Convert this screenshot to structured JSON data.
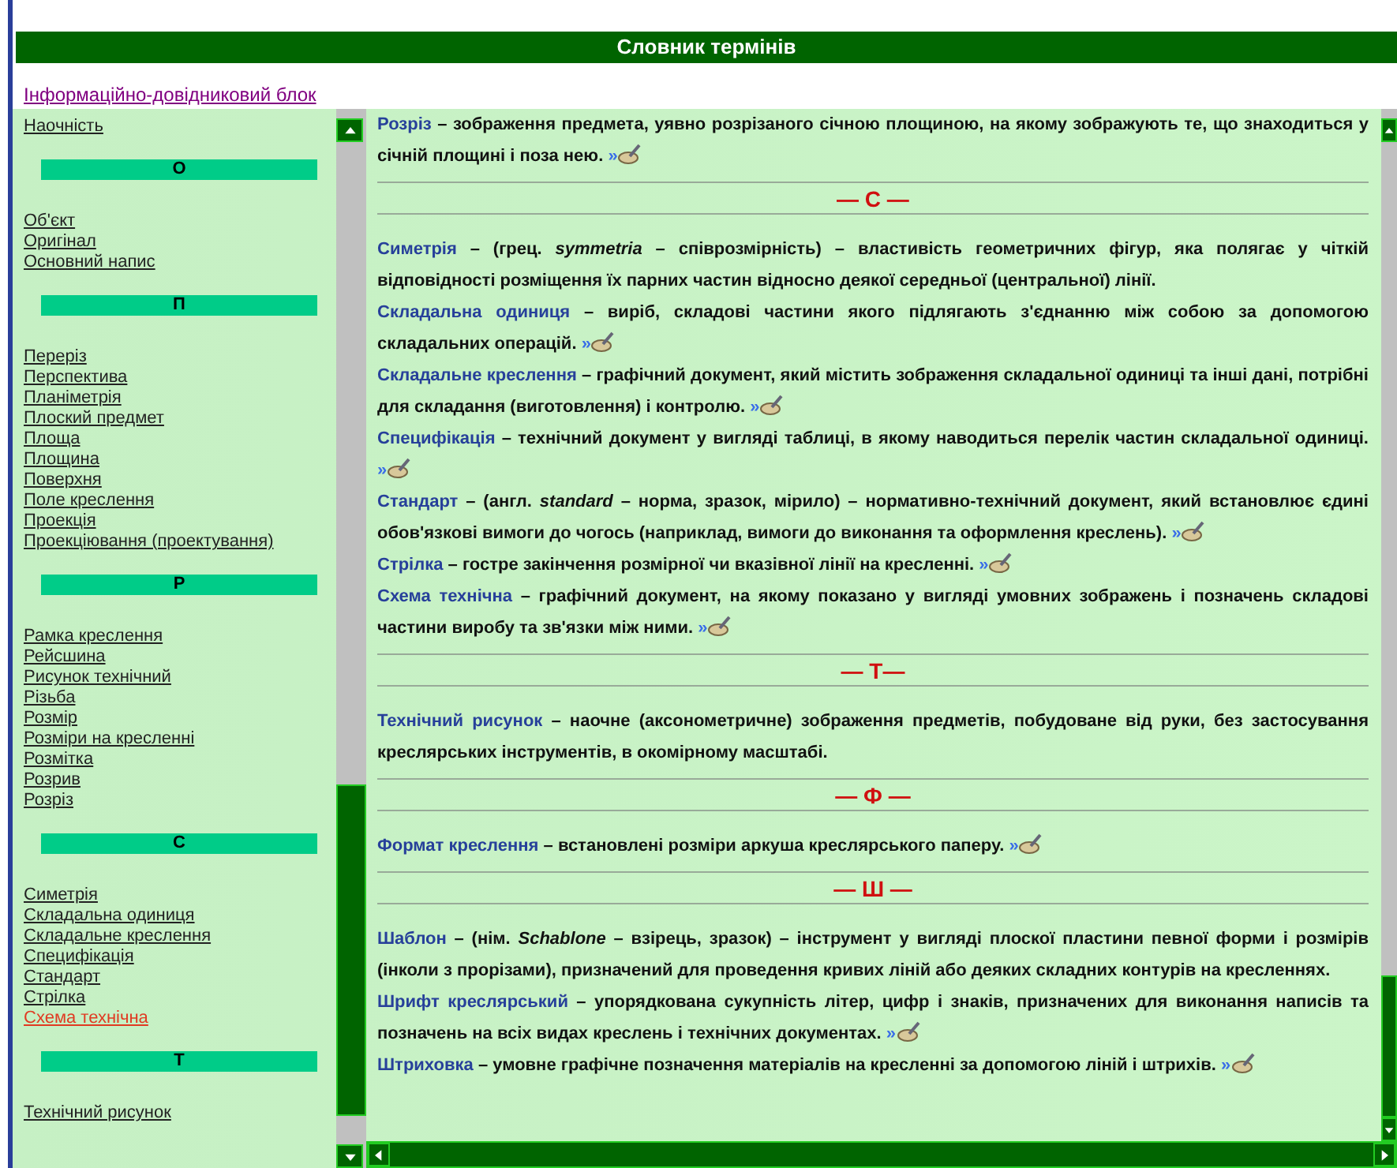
{
  "window": {
    "title": "Словник термінів"
  },
  "breadcrumb": {
    "label": "Інформаційно-довідниковий блок"
  },
  "sidebar": {
    "items": [
      {
        "kind": "link",
        "label": "Наочність",
        "selected": false
      },
      {
        "kind": "header",
        "label": "О"
      },
      {
        "kind": "link",
        "label": "Об'єкт",
        "selected": false
      },
      {
        "kind": "link",
        "label": "Оригінал",
        "selected": false
      },
      {
        "kind": "link",
        "label": "Основний напис",
        "selected": false
      },
      {
        "kind": "header",
        "label": "П"
      },
      {
        "kind": "link",
        "label": "Переріз",
        "selected": false
      },
      {
        "kind": "link",
        "label": "Перспектива",
        "selected": false
      },
      {
        "kind": "link",
        "label": "Планіметрія",
        "selected": false
      },
      {
        "kind": "link",
        "label": "Плоский предмет",
        "selected": false
      },
      {
        "kind": "link",
        "label": "Площа",
        "selected": false
      },
      {
        "kind": "link",
        "label": "Площина",
        "selected": false
      },
      {
        "kind": "link",
        "label": "Поверхня",
        "selected": false
      },
      {
        "kind": "link",
        "label": "Поле креслення",
        "selected": false
      },
      {
        "kind": "link",
        "label": "Проекція",
        "selected": false
      },
      {
        "kind": "link",
        "label": "Проекціювання (проектування)",
        "selected": false
      },
      {
        "kind": "header",
        "label": "Р"
      },
      {
        "kind": "link",
        "label": "Рамка креслення",
        "selected": false
      },
      {
        "kind": "link",
        "label": "Рейсшина",
        "selected": false
      },
      {
        "kind": "link",
        "label": "Рисунок технічний",
        "selected": false
      },
      {
        "kind": "link",
        "label": "Різьба",
        "selected": false
      },
      {
        "kind": "link",
        "label": "Розмір",
        "selected": false
      },
      {
        "kind": "link",
        "label": "Розміри на кресленні",
        "selected": false
      },
      {
        "kind": "link",
        "label": "Розмітка",
        "selected": false
      },
      {
        "kind": "link",
        "label": "Розрив",
        "selected": false
      },
      {
        "kind": "link",
        "label": "Розріз",
        "selected": false
      },
      {
        "kind": "header",
        "label": "С"
      },
      {
        "kind": "link",
        "label": "Симетрія",
        "selected": false
      },
      {
        "kind": "link",
        "label": "Складальна одиниця",
        "selected": false
      },
      {
        "kind": "link",
        "label": "Складальне креслення",
        "selected": false
      },
      {
        "kind": "link",
        "label": "Специфікація",
        "selected": false
      },
      {
        "kind": "link",
        "label": "Стандарт",
        "selected": false
      },
      {
        "kind": "link",
        "label": "Стрілка",
        "selected": false
      },
      {
        "kind": "link",
        "label": "Схема технічна",
        "selected": true
      },
      {
        "kind": "header",
        "label": "Т"
      },
      {
        "kind": "link",
        "label": "Технічний рисунок",
        "selected": false
      }
    ]
  },
  "content": {
    "entries": [
      {
        "kind": "entry",
        "term": "Розріз",
        "definition": "– зображення предмета, уявно розрізаного січною площиною, на якому зображують те, що знаходиться у січній площині і поза нею.",
        "more": "»"
      },
      {
        "kind": "letter",
        "label": "— С —"
      },
      {
        "kind": "entry",
        "term": "Симетрія",
        "definition": "– (грец. *symmetria* – співрозмірність) – властивість геометричних фігур, яка полягає у чіткій відповідності розміщення їх парних частин відносно деякої середньої (центральної) лінії."
      },
      {
        "kind": "entry",
        "term": "Складальна одиниця",
        "definition": "– виріб, складові частини якого підлягають з'єднанню між собою за допомогою складальних операцій.",
        "more": "»"
      },
      {
        "kind": "entry",
        "term": "Складальне креслення",
        "definition": "– графічний документ, який містить зображення складальної одиниці та інші дані, потрібні для складання (виготовлення) і контролю.",
        "more": "»"
      },
      {
        "kind": "entry",
        "term": "Специфікація",
        "definition": "– технічний документ у вигляді таблиці, в якому наводиться перелік частин складальної одиниці.",
        "more": "»"
      },
      {
        "kind": "entry",
        "term": "Стандарт",
        "definition": "– (англ. *standard* – норма, зразок, мірило) – нормативно-технічний документ, який встановлює єдині обов'язкові вимоги до чогось (наприклад, вимоги до виконання та оформлення креслень).",
        "more": "»"
      },
      {
        "kind": "entry",
        "term": "Стрілка",
        "definition": "– гостре закінчення розмірної чи вказівної лінії на кресленні.",
        "more": "»"
      },
      {
        "kind": "entry",
        "term": "Схема технічна",
        "definition": "– графічний документ, на якому показано у вигляді умовних зображень і позначень складові частини виробу та зв'язки між ними.",
        "more": "»"
      },
      {
        "kind": "letter",
        "label": "— Т—"
      },
      {
        "kind": "entry",
        "term": "Технічний рисунок",
        "definition": "– наочне (аксонометричне) зображення предметів, побудоване від руки, без застосування креслярських інструментів, в окомірному масштабі."
      },
      {
        "kind": "letter",
        "label": "— Ф —"
      },
      {
        "kind": "entry",
        "term": "Формат креслення",
        "definition": "– встановлені розміри аркуша креслярського паперу.",
        "more": "»"
      },
      {
        "kind": "letter",
        "label": "— Ш —"
      },
      {
        "kind": "entry",
        "term": "Шаблон",
        "definition": "– (нім. *Schablone* – взірець, зразок) – інструмент у вигляді плоскої пластини певної форми і розмірів (інколи з прорізами), призначений для проведення кривих ліній або деяких складних контурів на кресленнях."
      },
      {
        "kind": "entry",
        "term": "Шрифт креслярський",
        "definition": "– упорядкована сукупність літер, цифр і знаків, призначених для виконання написів та позначень на всіх видах креслень і технічних документах.",
        "more": "»"
      },
      {
        "kind": "entry",
        "term": "Штриховка",
        "definition": "– умовне графічне позначення матеріалів на кресленні за допомогою ліній і штрихів.",
        "more": "»"
      }
    ]
  }
}
